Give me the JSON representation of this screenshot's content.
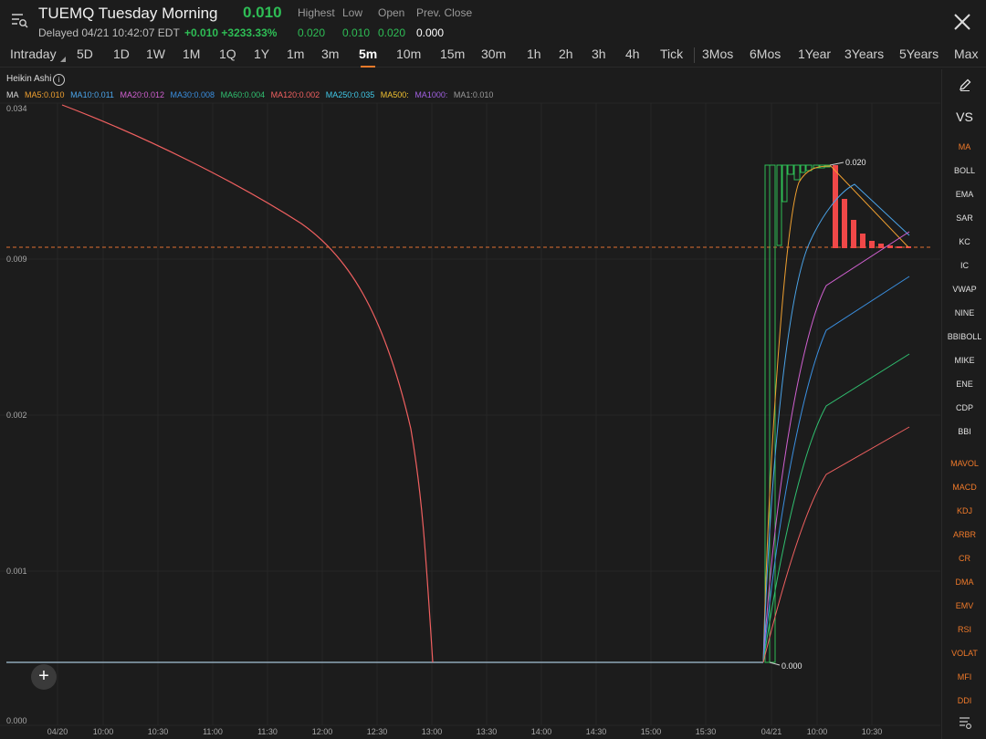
{
  "header": {
    "title": "TUEMQ Tuesday Morning",
    "price": "0.010",
    "status": "Delayed 04/21 10:42:07 EDT",
    "change_abs": "+0.010",
    "change_pct": "+3233.33%",
    "stats": [
      {
        "label": "Highest",
        "value": "0.020",
        "color": "#2ebd55"
      },
      {
        "label": "Low",
        "value": "0.010",
        "color": "#2ebd55"
      },
      {
        "label": "Open",
        "value": "0.020",
        "color": "#2ebd55"
      },
      {
        "label": "Prev. Close",
        "value": "0.000",
        "color": "#ffffff"
      }
    ],
    "menu_icon": "chart-menu-icon",
    "close_icon": "close-icon"
  },
  "tabs": [
    "Intraday",
    "5D",
    "1D",
    "1W",
    "1M",
    "1Q",
    "1Y",
    "1m",
    "3m",
    "5m",
    "10m",
    "15m",
    "30m",
    "1h",
    "2h",
    "3h",
    "4h",
    "Tick",
    "3Mos",
    "6Mos",
    "1Year",
    "3Years",
    "5Years",
    "Max"
  ],
  "active_tab": "5m",
  "chart": {
    "title": "Heikin Ashi",
    "info_icon": "info-icon",
    "ma_label": "MA",
    "ma_items": [
      {
        "text": "MA5:0.010",
        "color": "#f0a030"
      },
      {
        "text": "MA10:0.011",
        "color": "#4aa3e8"
      },
      {
        "text": "MA20:0.012",
        "color": "#d060d0"
      },
      {
        "text": "MA30:0.008",
        "color": "#3a8fe0"
      },
      {
        "text": "MA60:0.004",
        "color": "#30c070"
      },
      {
        "text": "MA120:0.002",
        "color": "#f06060"
      },
      {
        "text": "MA250:0.035",
        "color": "#40c8e8"
      },
      {
        "text": "MA500:",
        "color": "#f0c030"
      },
      {
        "text": "MA1000:",
        "color": "#a060e0"
      },
      {
        "text": "MA1:0.010",
        "color": "#9a9a9a"
      }
    ],
    "y_labels": [
      "0.034",
      "0.009",
      "0.002",
      "0.001",
      "0.000"
    ],
    "x_labels": [
      "04/20",
      "10:00",
      "10:30",
      "11:00",
      "11:30",
      "12:00",
      "12:30",
      "13:00",
      "13:30",
      "14:00",
      "14:30",
      "15:00",
      "15:30",
      "04/21",
      "10:00",
      "10:30"
    ],
    "high_marker": "0.020",
    "low_marker": "0.000",
    "plus_label": "+"
  },
  "sidebar": {
    "edit_icon": "pencil-icon",
    "vs_label": "VS",
    "items": [
      {
        "label": "MA",
        "orange": true
      },
      {
        "label": "BOLL",
        "orange": false
      },
      {
        "label": "EMA",
        "orange": false
      },
      {
        "label": "SAR",
        "orange": false
      },
      {
        "label": "KC",
        "orange": false
      },
      {
        "label": "IC",
        "orange": false
      },
      {
        "label": "VWAP",
        "orange": false
      },
      {
        "label": "NINE",
        "orange": false
      },
      {
        "label": "BBIBOLL",
        "orange": false
      },
      {
        "label": "MIKE",
        "orange": false
      },
      {
        "label": "ENE",
        "orange": false
      },
      {
        "label": "CDP",
        "orange": false
      },
      {
        "label": "BBI",
        "orange": false
      },
      {
        "label": "MAVOL",
        "orange": true
      },
      {
        "label": "MACD",
        "orange": true
      },
      {
        "label": "KDJ",
        "orange": true
      },
      {
        "label": "ARBR",
        "orange": true
      },
      {
        "label": "CR",
        "orange": true
      },
      {
        "label": "DMA",
        "orange": true
      },
      {
        "label": "EMV",
        "orange": true
      },
      {
        "label": "RSI",
        "orange": true
      },
      {
        "label": "VOLAT",
        "orange": true
      },
      {
        "label": "MFI",
        "orange": true
      },
      {
        "label": "DDI",
        "orange": true
      }
    ],
    "settings_icon": "indicator-settings-icon"
  }
}
